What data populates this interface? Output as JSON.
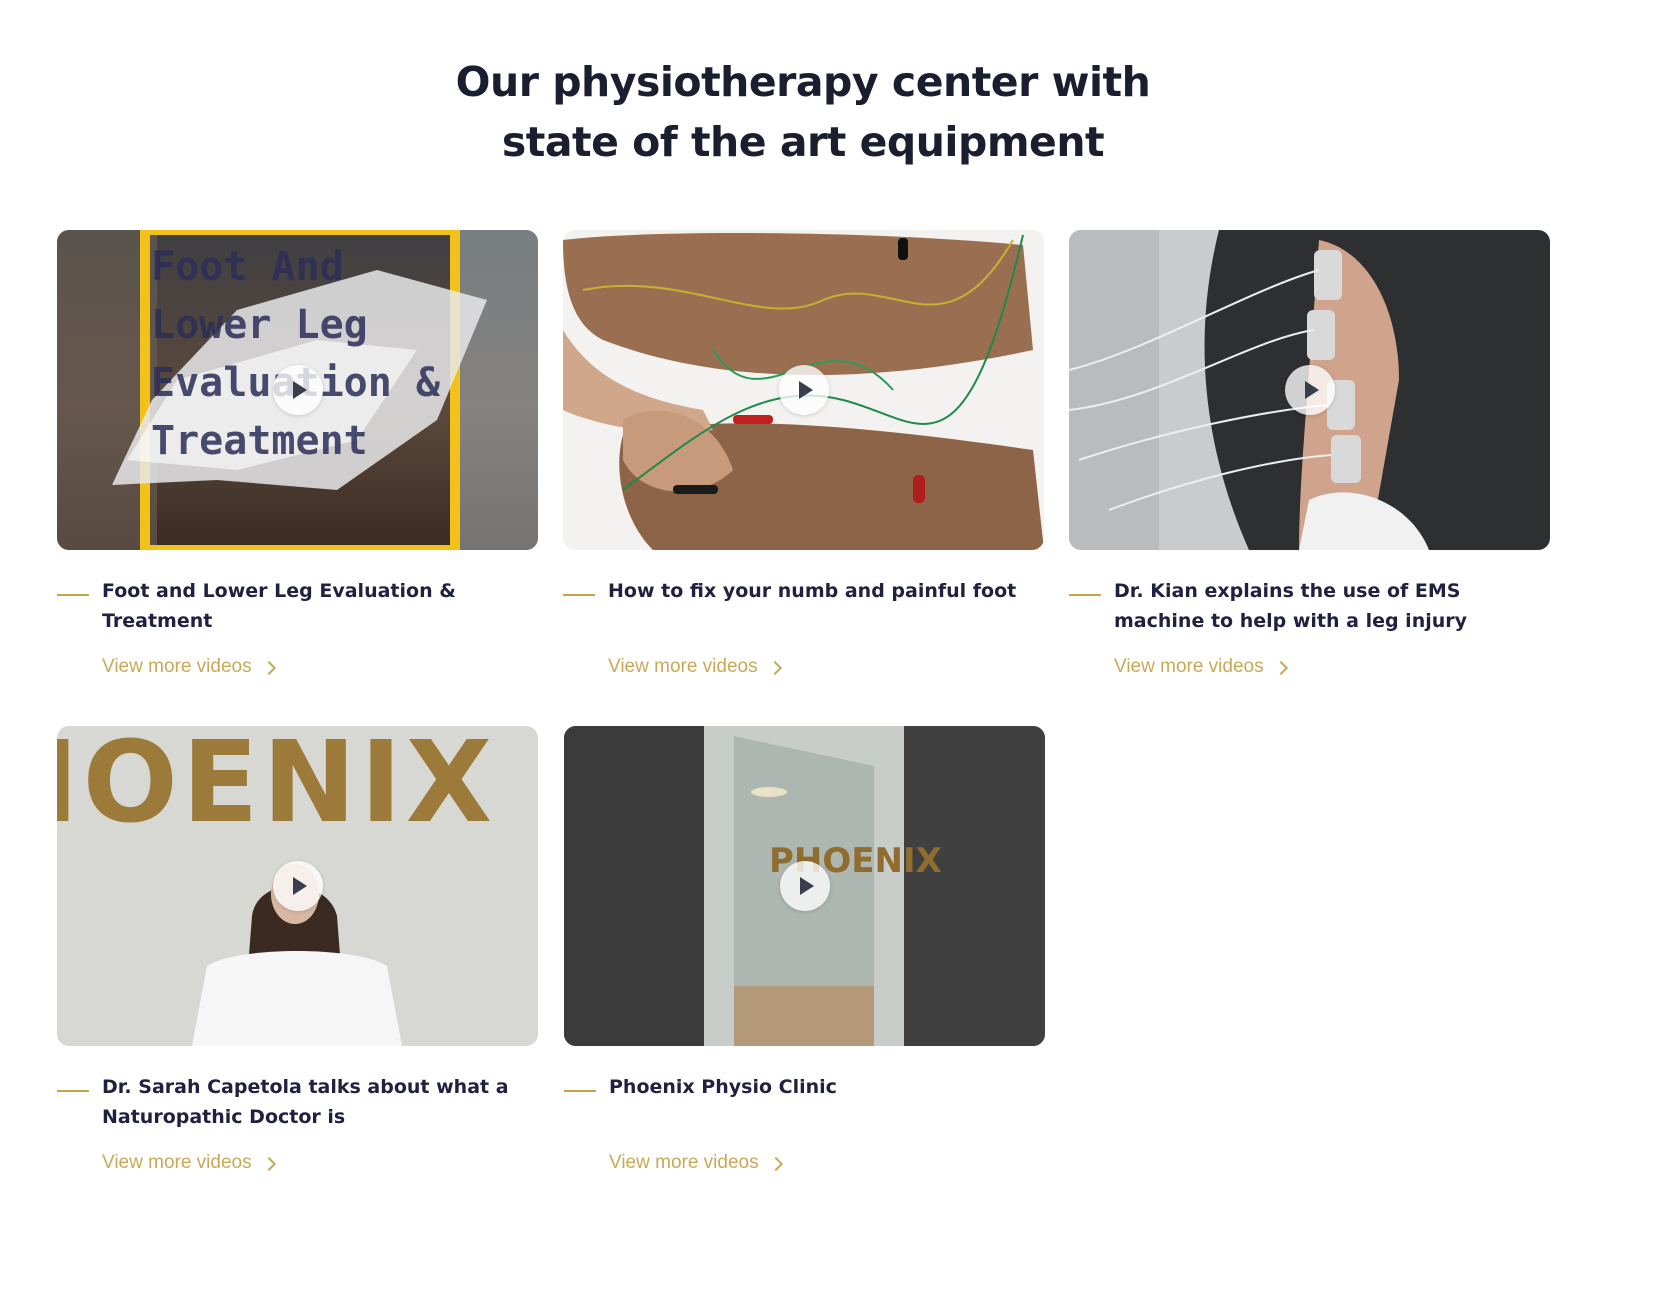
{
  "section": {
    "title_line1": "Our physiotherapy center with",
    "title_line2": "state of the art equipment"
  },
  "videos": [
    {
      "title": "Foot and Lower Leg Evaluation & Treatment",
      "link": "View more videos",
      "thumb_text": [
        "Foot  And",
        "Lower  Leg",
        "Evaluation &",
        "Treatment"
      ]
    },
    {
      "title": "How to fix your numb and painful foot",
      "link": "View more videos"
    },
    {
      "title": "Dr. Kian explains the use of EMS machine to help with a leg injury",
      "link": "View more videos"
    },
    {
      "title": "Dr. Sarah Capetola talks about what a Naturopathic Doctor is",
      "link": "View more videos",
      "thumb_text": "IOENIX"
    },
    {
      "title": "Phoenix Physio Clinic",
      "link": "View more videos",
      "thumb_text": "PHOENIX"
    }
  ],
  "icons": {
    "play": "play-icon",
    "chevron": "chevron-right-icon"
  },
  "colors": {
    "accent": "#c9a858",
    "heading": "#1b1e2e",
    "card_title": "#1f2140"
  }
}
